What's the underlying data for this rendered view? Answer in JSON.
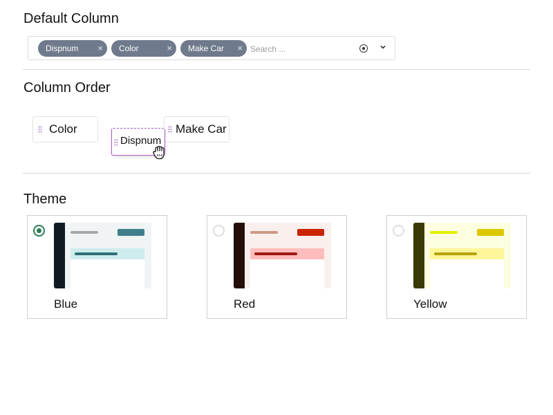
{
  "default_column": {
    "title": "Default Column",
    "chips": [
      {
        "label": "Dispnum"
      },
      {
        "label": "Color"
      },
      {
        "label": "Make Car"
      }
    ],
    "chip_remove_glyph": "×",
    "search_placeholder": "Search ..."
  },
  "column_order": {
    "title": "Column Order",
    "items": [
      {
        "label": "Color"
      },
      {
        "label": "Dispnum"
      },
      {
        "label": "Make Car"
      }
    ],
    "dragging_item": "Dispnum"
  },
  "theme": {
    "title": "Theme",
    "selected": "Blue",
    "options": [
      {
        "name": "Blue",
        "sidebar_color": "#0f1a22",
        "bg_color": "#f1f4f5",
        "band_color": "#cfeced",
        "accent_color": "#3f7f8b",
        "line_color": "#a7a7a7",
        "band_line_color": "#2f6f78"
      },
      {
        "name": "Red",
        "sidebar_color": "#240e07",
        "bg_color": "#f9f0ee",
        "band_color": "#ffbcbc",
        "accent_color": "#c92400",
        "line_color": "#c99c86",
        "band_line_color": "#9c1a12"
      },
      {
        "name": "Yellow",
        "sidebar_color": "#3a3a06",
        "bg_color": "#fdfee0",
        "band_color": "#fff59a",
        "accent_color": "#dcc700",
        "line_color": "#e6f000",
        "band_line_color": "#b5a200"
      }
    ]
  },
  "colors": {
    "chip_bg": "#6f7a8c",
    "radio_selected": "#2a7d54",
    "drag_border": "#a95cc7",
    "grip": "#b07ac8"
  }
}
